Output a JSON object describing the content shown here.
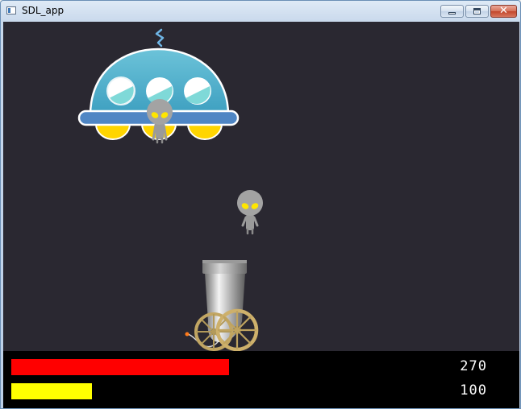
{
  "window": {
    "title": "SDL_app",
    "controls": {
      "minimize_icon": "minimize-icon",
      "maximize_icon": "maximize-icon",
      "close_glyph": "✕"
    }
  },
  "game": {
    "background_color": "#2a2831",
    "sprites": {
      "ufo": "ufo-sprite",
      "alien": "alien-sprite",
      "cannon": "cannon-sprite"
    }
  },
  "hud": {
    "health": {
      "value": 270,
      "max": 270,
      "color": "#ff0000"
    },
    "energy": {
      "value": 100,
      "max": 270,
      "color": "#ffff00"
    },
    "health_text": "270",
    "energy_text": "100"
  }
}
